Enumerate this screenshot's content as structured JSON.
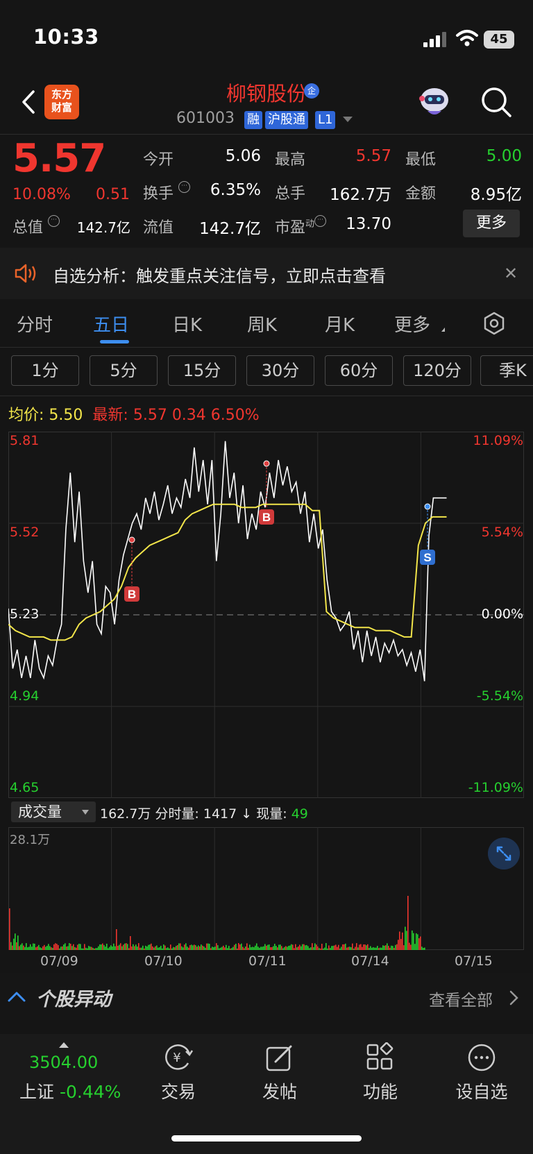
{
  "status": {
    "time": "10:33",
    "battery": "45"
  },
  "header": {
    "logo_line1": "东方",
    "logo_line2": "财富",
    "name": "柳钢股份",
    "corp_badge": "企",
    "code": "601003",
    "tags": [
      "融",
      "沪股通",
      "L1"
    ]
  },
  "quote": {
    "price": "5.57",
    "change_pct": "10.08%",
    "change_amt": "0.51",
    "fields": {
      "open_label": "今开",
      "open": "5.06",
      "high_label": "最高",
      "high": "5.57",
      "low_label": "最低",
      "low": "5.00",
      "turnover_label": "换手",
      "turnover": "6.35%",
      "volume_label": "总手",
      "volume": "162.7万",
      "amount_label": "金额",
      "amount": "8.95亿",
      "mktcap_label": "总值",
      "mktcap": "142.7亿",
      "float_label": "流值",
      "float": "142.7亿",
      "pe_label": "市盈",
      "pe_sup": "动",
      "pe": "13.70"
    },
    "more_label": "更多"
  },
  "banner": {
    "text": "自选分析：触发重点关注信号，立即点击查看"
  },
  "tabs": {
    "items": [
      "分时",
      "五日",
      "日K",
      "周K",
      "月K",
      "更多"
    ],
    "active": "五日"
  },
  "periods": [
    "1分",
    "5分",
    "15分",
    "30分",
    "60分",
    "120分",
    "季K"
  ],
  "chart_info": {
    "avg_label": "均价:",
    "avg": "5.50",
    "latest_label": "最新:",
    "latest": "5.57",
    "latest_chg": "0.34",
    "latest_pct": "6.50%"
  },
  "chart_data": {
    "type": "line",
    "price_axis": [
      "5.81",
      "5.52",
      "5.23",
      "4.94",
      "4.65"
    ],
    "pct_axis": [
      "11.09%",
      "5.54%",
      "0.00%",
      "-5.54%",
      "-11.09%"
    ],
    "ylim": [
      4.65,
      5.81
    ],
    "prev_close": 5.23,
    "x": [
      "07/09",
      "07/10",
      "07/11",
      "07/14",
      "07/15"
    ],
    "series": [
      {
        "values": [
          5.25,
          5.06,
          5.12,
          5.03,
          5.1,
          5.03,
          5.15,
          5.06,
          5.03,
          5.1,
          5.07,
          5.15,
          5.2,
          5.5,
          5.68,
          5.46,
          5.62,
          5.4,
          5.3,
          5.4,
          5.2,
          5.17,
          5.32,
          5.3,
          5.2,
          5.34,
          5.42,
          5.47,
          5.52,
          5.55,
          5.5,
          5.6,
          5.55,
          5.62,
          5.53,
          5.58,
          5.64,
          5.55,
          5.6,
          5.57,
          5.66,
          5.6,
          5.76,
          5.62,
          5.72,
          5.58,
          5.72,
          5.4,
          5.55,
          5.78,
          5.6,
          5.68,
          5.52,
          5.64,
          5.47,
          5.55,
          5.5,
          5.62,
          5.57,
          5.68,
          5.6,
          5.72,
          5.64,
          5.7,
          5.62,
          5.65,
          5.55,
          5.62,
          5.46,
          5.55,
          5.44,
          5.5,
          5.34,
          5.24,
          5.22,
          5.18,
          5.2,
          5.24,
          5.12,
          5.18,
          5.08,
          5.18,
          5.1,
          5.16,
          5.08,
          5.14,
          5.11,
          5.15,
          5.1,
          5.12,
          5.07,
          5.11,
          5.05,
          5.12,
          5.02,
          5.48,
          5.6,
          5.6,
          5.6,
          5.6
        ]
      },
      {
        "values": [
          5.2,
          5.18,
          5.17,
          5.16,
          5.16,
          5.16,
          5.15,
          5.15,
          5.15,
          5.16,
          5.2,
          5.22,
          5.23,
          5.24,
          5.26,
          5.28,
          5.32,
          5.38,
          5.41,
          5.43,
          5.45,
          5.46,
          5.47,
          5.48,
          5.49,
          5.53,
          5.55,
          5.56,
          5.57,
          5.58,
          5.58,
          5.58,
          5.58,
          5.57,
          5.57,
          5.57,
          5.58,
          5.58,
          5.58,
          5.58,
          5.58,
          5.58,
          5.58,
          5.56,
          5.56,
          5.24,
          5.22,
          5.21,
          5.2,
          5.19,
          5.19,
          5.19,
          5.18,
          5.18,
          5.18,
          5.17,
          5.16,
          5.16,
          5.45,
          5.52,
          5.54,
          5.54,
          5.54
        ]
      }
    ]
  },
  "volume": {
    "dropdown_label": "成交量",
    "info": "162.7万 分时量: 1417 ↓ 现量:",
    "info_green": "49",
    "max_label": "28.1万"
  },
  "movement": {
    "title": "个股异动",
    "view_all": "查看全部"
  },
  "nav": {
    "index_value": "3504.00",
    "index_name": "上证",
    "index_chg": "-0.44%",
    "items": [
      "交易",
      "发帖",
      "功能",
      "设自选"
    ]
  },
  "colors": {
    "up": "#f0362f",
    "down": "#26d02f",
    "accent": "#3d8ef0",
    "avg_line": "#f2e54a"
  }
}
